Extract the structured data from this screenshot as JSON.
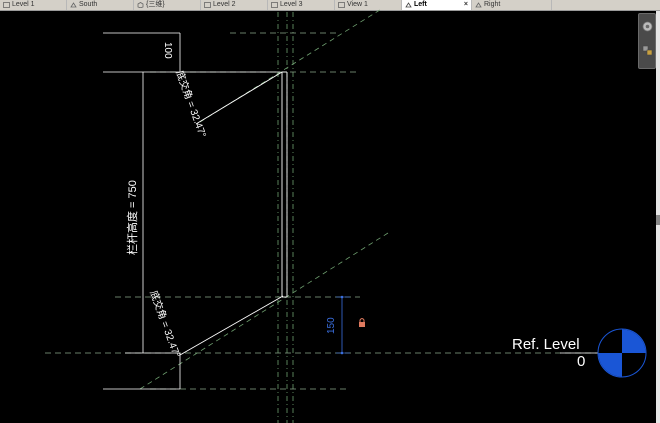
{
  "tabs": [
    {
      "label": "Level 1",
      "icon": "floor-plan-icon",
      "active": false
    },
    {
      "label": "South",
      "icon": "elevation-icon",
      "active": false
    },
    {
      "label": "{三维}",
      "icon": "3d-view-icon",
      "active": false
    },
    {
      "label": "Level 2",
      "icon": "floor-plan-icon",
      "active": false
    },
    {
      "label": "Level 3",
      "icon": "floor-plan-icon",
      "active": false
    },
    {
      "label": "View 1",
      "icon": "floor-plan-icon",
      "active": false
    },
    {
      "label": "Left",
      "icon": "elevation-icon",
      "active": true
    },
    {
      "label": "Right",
      "icon": "elevation-icon",
      "active": false
    }
  ],
  "close_glyph": "×",
  "dimensions": {
    "top_offset": "100",
    "angle_top": "底交角 = 32.47°",
    "baluster_height": "栏杆高度 = 750",
    "angle_bottom": "底交角 = 32.47°",
    "blue_offset": "150"
  },
  "level": {
    "name": "Ref. Level",
    "elevation": "0",
    "color_blue": "#1a56d6"
  },
  "colors": {
    "line": "#ffffff",
    "dash_green": "#6fa070",
    "dim_blue": "#3a6fe0",
    "lock": "#e07a5f"
  }
}
